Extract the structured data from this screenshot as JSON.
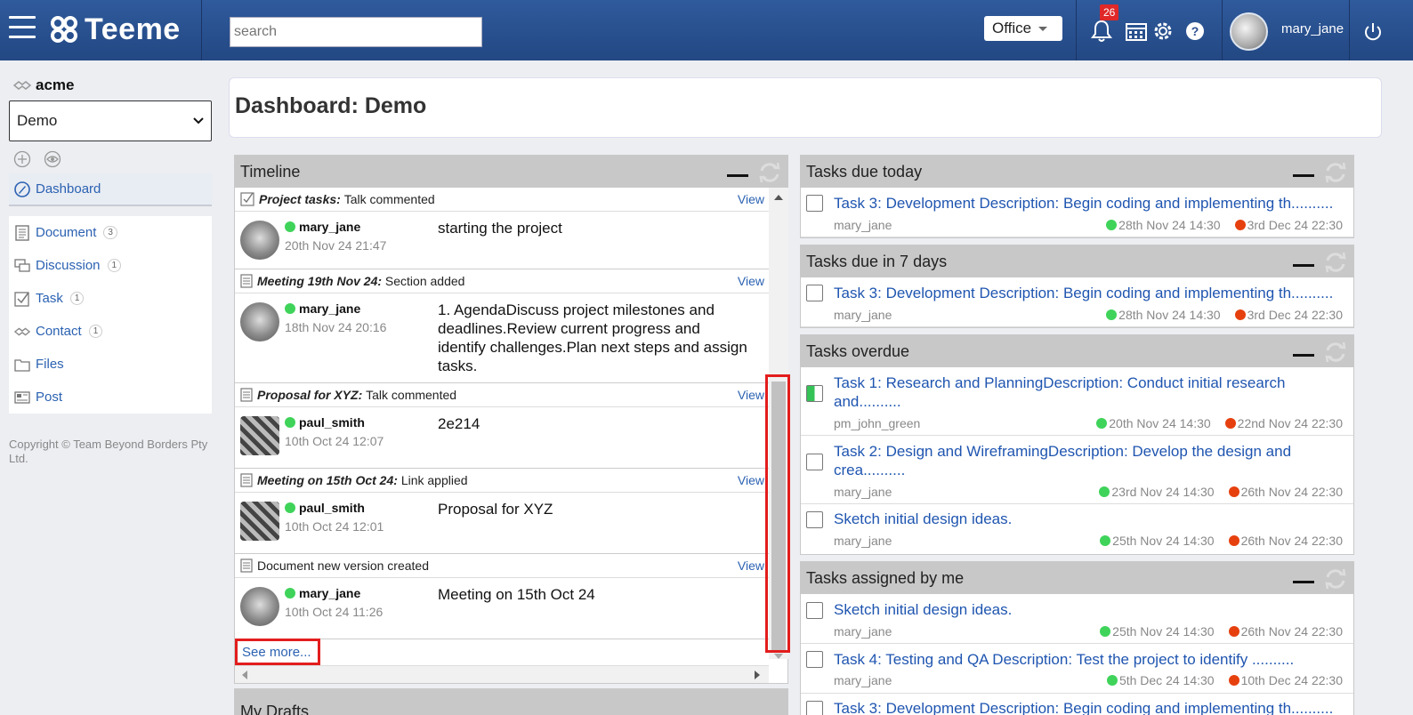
{
  "header": {
    "logo_text": "Teeme",
    "search_placeholder": "search",
    "workspace": "Office",
    "notification_count": "26",
    "username": "mary_jane",
    "icons": [
      "menu-icon",
      "bell-icon",
      "calendar-icon",
      "gear-icon",
      "help-icon",
      "power-icon"
    ]
  },
  "sidebar": {
    "org": "acme",
    "dashboard_select": "Demo",
    "items": [
      {
        "label": "Dashboard",
        "count": "",
        "icon": "dashboard-icon"
      },
      {
        "label": "Document",
        "count": "3",
        "icon": "document-icon"
      },
      {
        "label": "Discussion",
        "count": "1",
        "icon": "discussion-icon"
      },
      {
        "label": "Task",
        "count": "1",
        "icon": "task-icon"
      },
      {
        "label": "Contact",
        "count": "1",
        "icon": "contact-icon"
      },
      {
        "label": "Files",
        "count": "",
        "icon": "folder-icon"
      },
      {
        "label": "Post",
        "count": "",
        "icon": "post-icon"
      }
    ],
    "copyright": "Copyright © Team Beyond Borders Pty Ltd."
  },
  "page": {
    "title": "Dashboard: Demo"
  },
  "timeline": {
    "title": "Timeline",
    "view_label": "View",
    "see_more": "See more...",
    "items": [
      {
        "context": "Project tasks:",
        "action": "Talk commented",
        "user": "mary_jane",
        "time": "20th Nov 24 21:47",
        "text": "starting the project"
      },
      {
        "context": "Meeting 19th Nov 24:",
        "action": "Section added",
        "user": "mary_jane",
        "time": "18th Nov 24 20:16",
        "text": "1. AgendaDiscuss project milestones and deadlines.Review current progress and identify challenges.Plan next steps and assign tasks."
      },
      {
        "context": "Proposal for XYZ:",
        "action": "Talk commented",
        "user": "paul_smith",
        "time": "10th Oct 24 12:07",
        "text": "2e214"
      },
      {
        "context": "Meeting on 15th Oct 24:",
        "action": "Link applied",
        "user": "paul_smith",
        "time": "10th Oct 24 12:01",
        "text": "Proposal for XYZ"
      },
      {
        "context": "",
        "action": "Document new version created",
        "user": "mary_jane",
        "time": "10th Oct 24 11:26",
        "text": "Meeting on 15th Oct 24"
      }
    ]
  },
  "drafts": {
    "title": "My Drafts"
  },
  "tasks_today": {
    "title": "Tasks due today",
    "items": [
      {
        "title": "Task 3: Development Description: Begin coding and implementing th..........",
        "user": "mary_jane",
        "start": "28th Nov 24 14:30",
        "end": "3rd Dec 24 22:30"
      }
    ]
  },
  "tasks_week": {
    "title": "Tasks due in 7 days",
    "items": [
      {
        "title": "Task 3: Development Description: Begin coding and implementing th..........",
        "user": "mary_jane",
        "start": "28th Nov 24 14:30",
        "end": "3rd Dec 24 22:30"
      }
    ]
  },
  "tasks_overdue": {
    "title": "Tasks overdue",
    "items": [
      {
        "title": "Task 1: Research and PlanningDescription: Conduct initial research and..........",
        "user": "pm_john_green",
        "start": "20th Nov 24 14:30",
        "end": "22nd Nov 24 22:30",
        "progress": 0.5
      },
      {
        "title": "Task 2: Design and WireframingDescription: Develop the design and crea..........",
        "user": "mary_jane",
        "start": "23rd Nov 24 14:30",
        "end": "26th Nov 24 22:30"
      },
      {
        "title": "Sketch initial design ideas.",
        "user": "mary_jane",
        "start": "25th Nov 24 14:30",
        "end": "26th Nov 24 22:30"
      }
    ]
  },
  "tasks_assigned": {
    "title": "Tasks assigned by me",
    "items": [
      {
        "title": "Sketch initial design ideas.",
        "user": "mary_jane",
        "start": "25th Nov 24 14:30",
        "end": "26th Nov 24 22:30"
      },
      {
        "title": "Task 4: Testing and QA Description: Test the project to identify ..........",
        "user": "mary_jane",
        "start": "5th Dec 24 14:30",
        "end": "10th Dec 24 22:30"
      },
      {
        "title": "Task 3: Development Description: Begin coding and implementing th..........",
        "user": "",
        "start": "",
        "end": ""
      }
    ]
  },
  "colors": {
    "brand": "#2b4f8e",
    "link": "#2b62b2",
    "start_dot": "#3fd35a",
    "end_dot": "#e6400f",
    "highlight": "#e31d1d"
  }
}
